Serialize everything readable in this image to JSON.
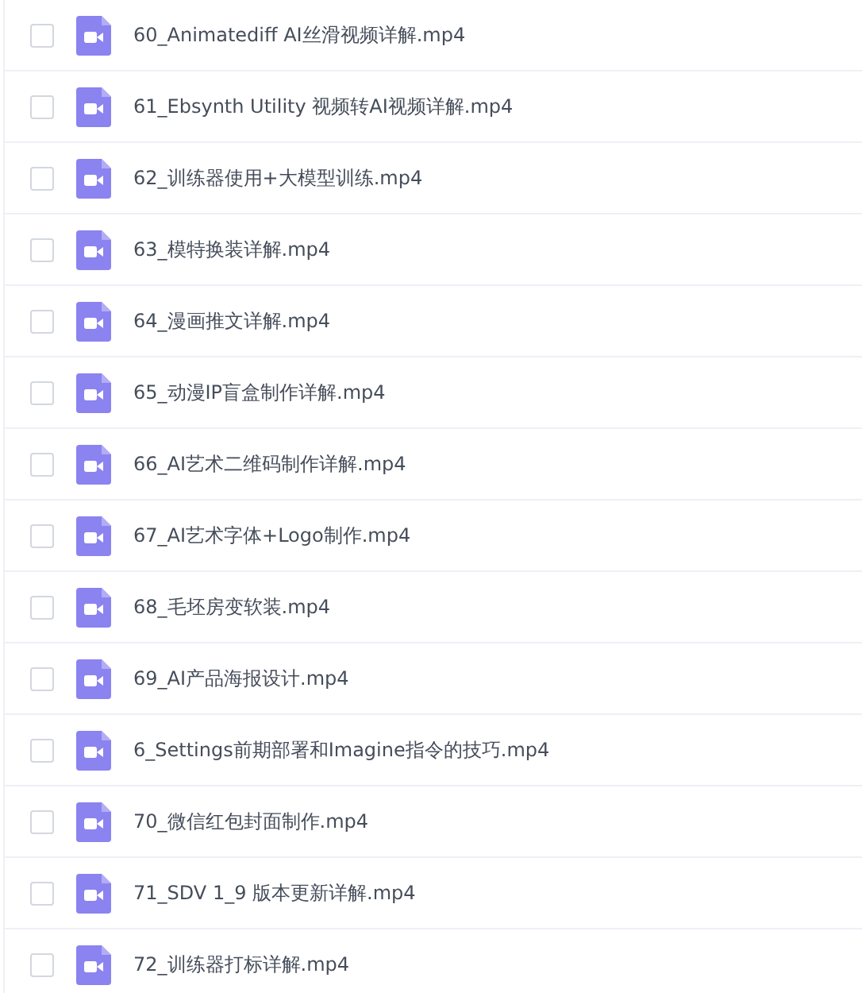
{
  "files": [
    {
      "name": "60_Animatediff AI丝滑视频详解.mp4",
      "checked": false
    },
    {
      "name": "61_Ebsynth Utility 视频转AI视频详解.mp4",
      "checked": false
    },
    {
      "name": "62_训练器使用+大模型训练.mp4",
      "checked": false
    },
    {
      "name": "63_模特换装详解.mp4",
      "checked": false
    },
    {
      "name": "64_漫画推文详解.mp4",
      "checked": false
    },
    {
      "name": "65_动漫IP盲盒制作详解.mp4",
      "checked": false
    },
    {
      "name": "66_AI艺术二维码制作详解.mp4",
      "checked": false
    },
    {
      "name": "67_AI艺术字体+Logo制作.mp4",
      "checked": false
    },
    {
      "name": "68_毛坯房变软装.mp4",
      "checked": false
    },
    {
      "name": "69_AI产品海报设计.mp4",
      "checked": false
    },
    {
      "name": "6_Settings前期部署和Imagine指令的技巧.mp4",
      "checked": false
    },
    {
      "name": "70_微信红包封面制作.mp4",
      "checked": false
    },
    {
      "name": "71_SDV 1_9 版本更新详解.mp4",
      "checked": false
    },
    {
      "name": "72_训练器打标详解.mp4",
      "checked": false
    }
  ]
}
